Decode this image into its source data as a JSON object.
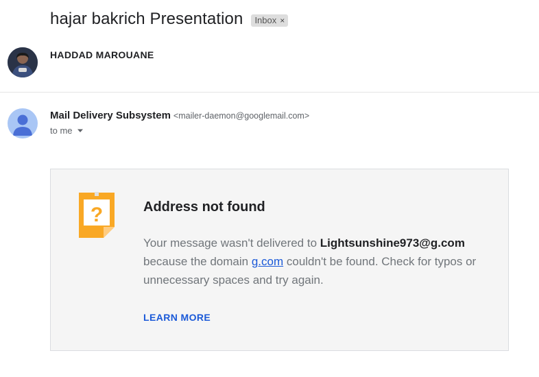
{
  "subject": "hajar bakrich Presentation",
  "label_chip": {
    "text": "Inbox",
    "close": "×"
  },
  "thread": {
    "first_sender": "HADDAD MAROUANE",
    "message": {
      "sender_name": "Mail Delivery Subsystem",
      "sender_email": "<mailer-daemon@googlemail.com>",
      "recipient": "to me"
    }
  },
  "bounce": {
    "title": "Address not found",
    "body_prefix": "Your message wasn't delivered to ",
    "address": "Lightsunshine973@g.com",
    "body_mid": " because the domain ",
    "domain": "g.com",
    "body_suffix": " couldn't be found. Check for typos or unnecessary spaces and try again.",
    "learn_more": "LEARN MORE",
    "icon": "question-mark-warning-icon",
    "icon_color": "#f9a825"
  },
  "colors": {
    "link": "#1a59d8",
    "card_bg": "#f5f5f5",
    "avatar_default": "#a9c6f5"
  }
}
